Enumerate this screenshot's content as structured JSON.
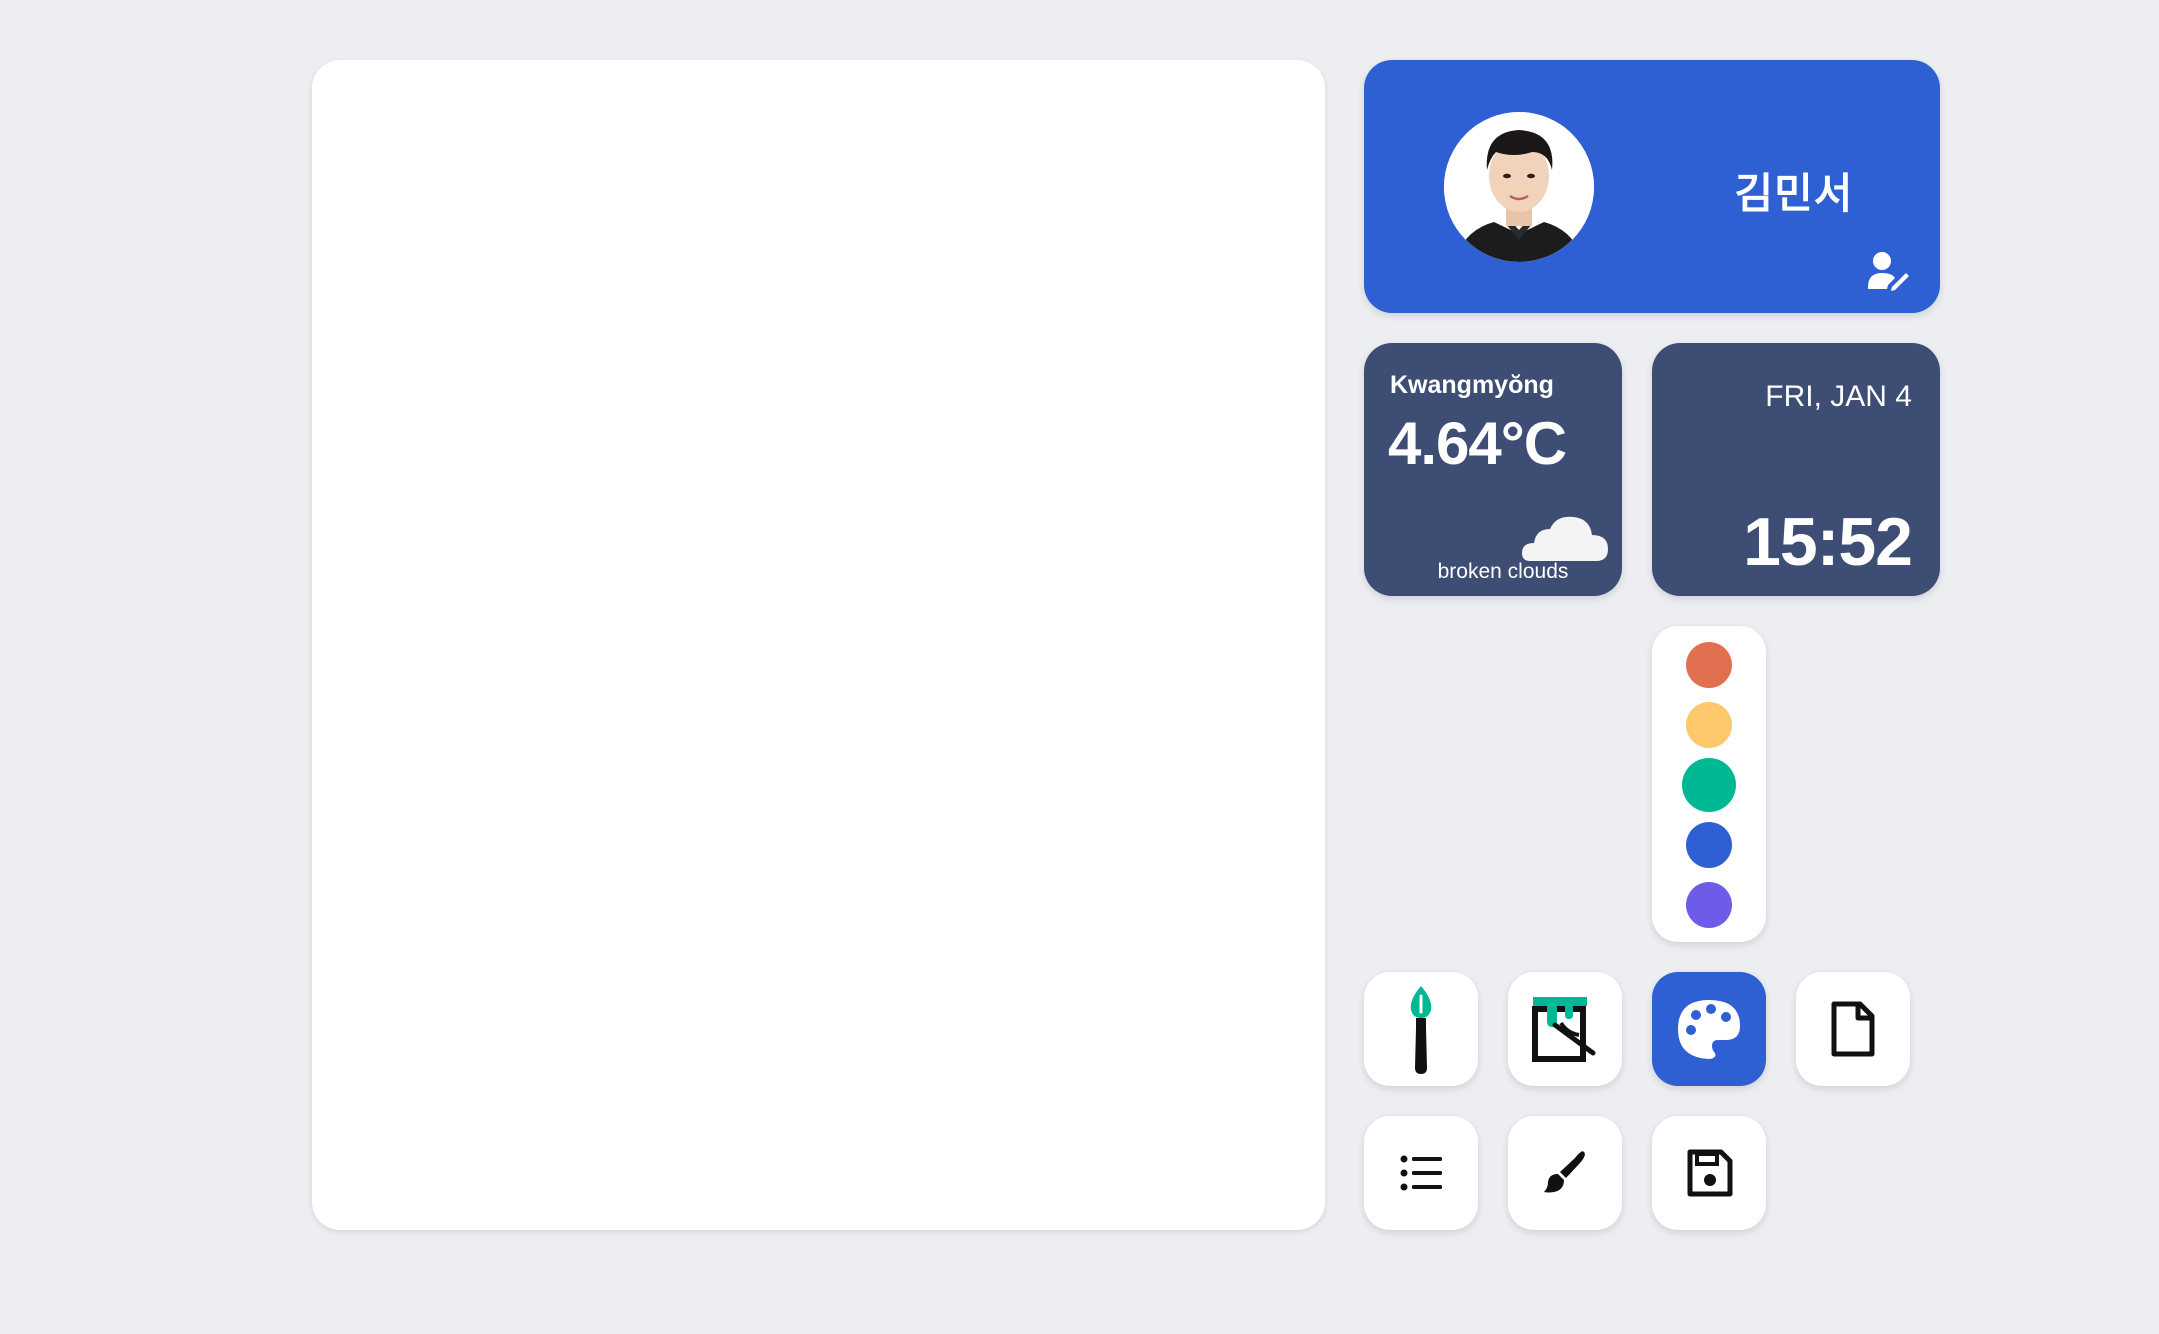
{
  "profile": {
    "name": "김민서",
    "avatar_icon": "user-avatar",
    "edit_icon": "user-edit-icon"
  },
  "weather": {
    "city": "Kwangmyŏng",
    "temperature": "4.64°C",
    "description": "broken clouds",
    "icon": "cloud-icon"
  },
  "clock": {
    "date": "FRI, JAN 4",
    "time": "15:52"
  },
  "palette": {
    "colors": [
      "#e0704f",
      "#fcc86b",
      "#00b894",
      "#2f60d3",
      "#6c5ce7"
    ],
    "selected_index": 2
  },
  "toolbar": {
    "tools": [
      {
        "name": "brush-tool",
        "icon": "paintbrush-icon",
        "active": false
      },
      {
        "name": "fill-tool",
        "icon": "paint-bucket-icon",
        "active": false
      },
      {
        "name": "palette-tool",
        "icon": "palette-icon",
        "active": true
      },
      {
        "name": "new-file-tool",
        "icon": "file-icon",
        "active": false
      },
      {
        "name": "list-tool",
        "icon": "list-icon",
        "active": false
      },
      {
        "name": "paint-tool",
        "icon": "brush-icon",
        "active": false
      },
      {
        "name": "save-tool",
        "icon": "floppy-disk-icon",
        "active": false
      }
    ]
  },
  "colors": {
    "accent": "#2f60d3",
    "card_dark": "#3d4d74",
    "background": "#eceef2"
  }
}
